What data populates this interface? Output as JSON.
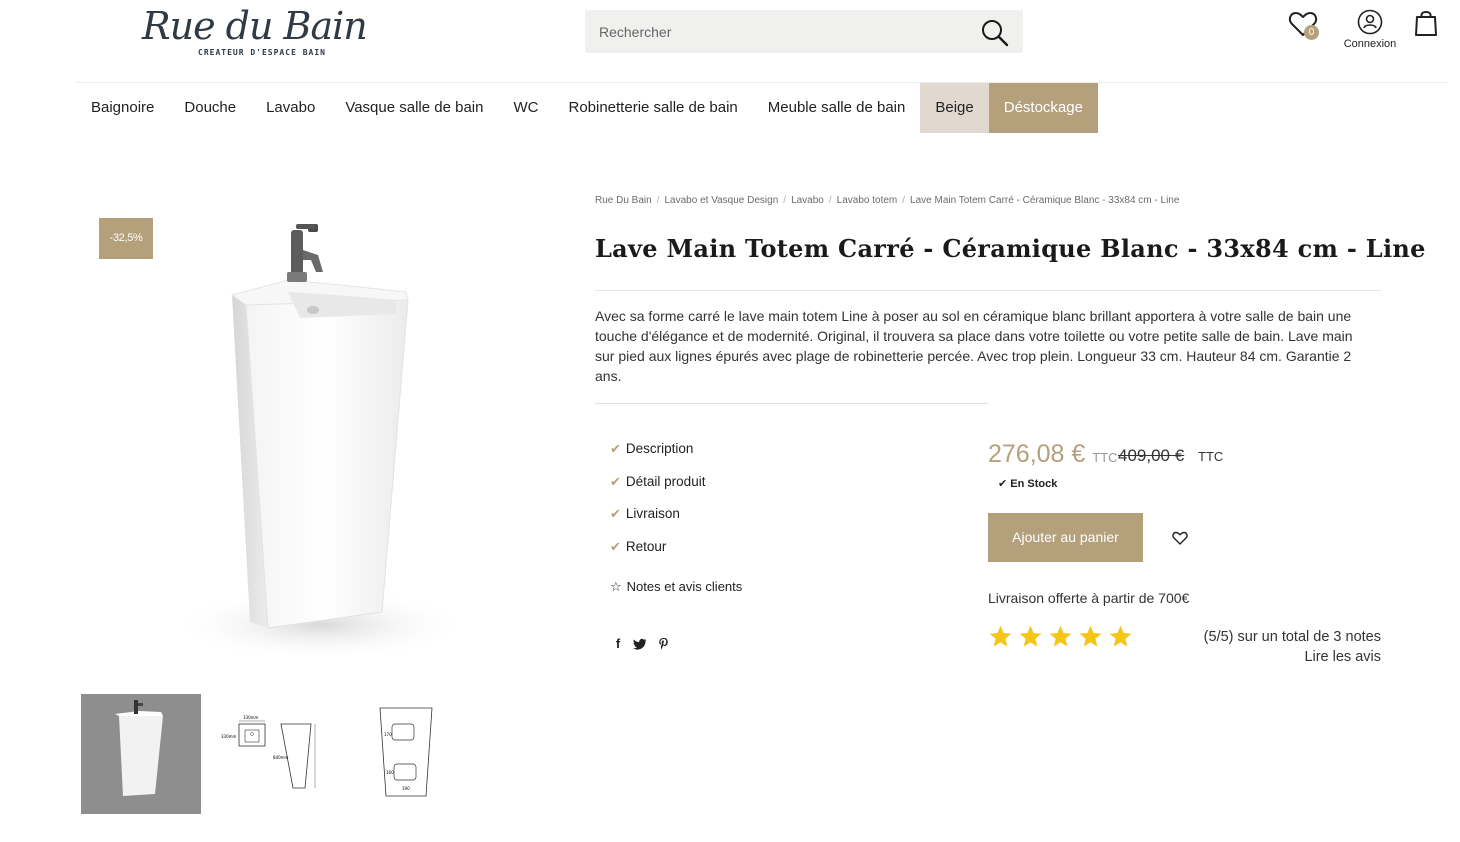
{
  "brand": {
    "logo_text": "Rue du Bain",
    "tagline": "CREATEUR D'ESPACE BAIN"
  },
  "search": {
    "placeholder": "Rechercher"
  },
  "header": {
    "wishlist_count": "0",
    "account_label": "Connexion"
  },
  "nav": {
    "items": [
      {
        "label": "Baignoire"
      },
      {
        "label": "Douche"
      },
      {
        "label": "Lavabo"
      },
      {
        "label": "Vasque salle de bain"
      },
      {
        "label": "WC"
      },
      {
        "label": "Robinetterie salle de bain"
      },
      {
        "label": "Meuble salle de bain"
      },
      {
        "label": "Beige"
      },
      {
        "label": "Déstockage"
      }
    ]
  },
  "gallery": {
    "discount_badge": "-32,5%"
  },
  "breadcrumb": [
    "Rue Du Bain",
    "Lavabo et Vasque Design",
    "Lavabo",
    "Lavabo totem",
    "Lave Main Totem Carré - Céramique Blanc - 33x84 cm - Line"
  ],
  "product": {
    "title": "Lave Main Totem Carré - Céramique Blanc - 33x84 cm - Line",
    "description": "Avec sa forme carré le lave main totem Line à poser au sol en céramique blanc brillant apportera à votre salle de bain une touche d'élégance et de modernité. Original, il trouvera sa place dans votre toilette ou votre petite salle de bain. Lave main sur pied aux lignes épurés avec plage de robinetterie percée. Avec trop plein. Longueur 33 cm. Hauteur 84 cm. Garantie 2 ans.",
    "price": "276,08 €",
    "price_suffix": "TTC",
    "old_price": "409,00 €",
    "old_price_suffix": "TTC",
    "stock": "En Stock",
    "add_to_cart": "Ajouter au panier",
    "free_shipping": "Livraison offerte à partir de 700€"
  },
  "tabs": [
    "Description",
    "Détail produit",
    "Livraison",
    "Retour"
  ],
  "reviews": {
    "tab_label": "Notes et avis clients",
    "rating": 5,
    "max_rating": 5,
    "summary": "(5/5) sur un total de 3 notes",
    "read_link": "Lire les avis"
  },
  "share_icons": [
    "facebook-icon",
    "twitter-icon",
    "pinterest-icon"
  ],
  "colors": {
    "accent": "#b5a07c",
    "beige": "#e1d9cf",
    "star": "#f5c518"
  }
}
